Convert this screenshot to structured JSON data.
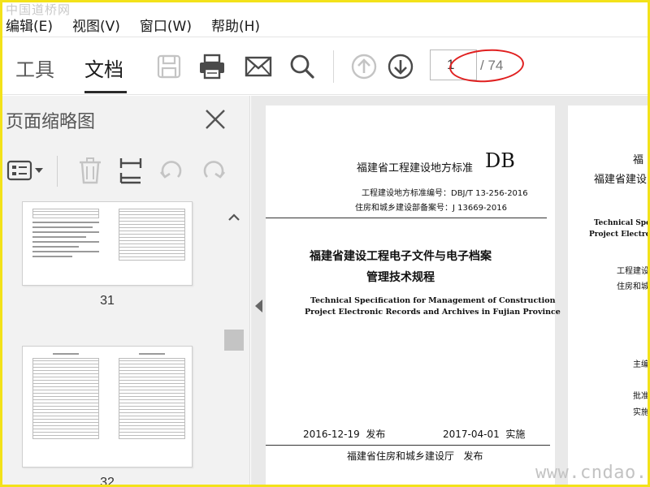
{
  "watermark": {
    "top": "中国道桥网",
    "bottom": "www.cndao.com"
  },
  "menu": [
    "编辑(E)",
    "视图(V)",
    "窗口(W)",
    "帮助(H)"
  ],
  "tabs": [
    {
      "label": "工具",
      "active": false
    },
    {
      "label": "文档",
      "active": true
    }
  ],
  "toolbar": {
    "icons": [
      "save-icon",
      "print-icon",
      "email-icon",
      "search-icon",
      "page-up-icon",
      "page-down-icon"
    ],
    "page_current": "1",
    "page_total": "/ 74",
    "annotation_color": "#e02020"
  },
  "sidebar": {
    "title": "页面缩略图",
    "tools": [
      "thumbnail-options-icon",
      "delete-icon",
      "extract-icon",
      "rotate-left-icon",
      "rotate-right-icon"
    ],
    "thumbnails": [
      {
        "label": "31"
      },
      {
        "label": "32"
      }
    ]
  },
  "document": {
    "page1": {
      "standard_title": "福建省工程建设地方标准",
      "standard_code": "DB",
      "number_line": "工程建设地方标准编号：DBJ/T 13-256-2016",
      "record_line": "住房和城乡建设部备案号：J 13669-2016",
      "title_cn_1": "福建省建设工程电子文件与电子档案",
      "title_cn_2": "管理技术规程",
      "title_en_1": "Technical Specification for Management of Construction",
      "title_en_2": "Project Electronic Records and Archives in Fujian Province",
      "issue_date": "2016-12-19",
      "issue_label": "发布",
      "impl_date": "2017-04-01",
      "impl_label": "实施",
      "publisher": "福建省住房和城乡建设厅",
      "publisher_label": "发布"
    },
    "page2": {
      "line1": "福",
      "line2": "福建省建设",
      "en1": "Technical Specifi",
      "en2": "Project Electroni",
      "cn1": "工程建设",
      "cn2": "住房和城",
      "r1": "主编",
      "r2": "批准",
      "r3": "实施"
    }
  }
}
